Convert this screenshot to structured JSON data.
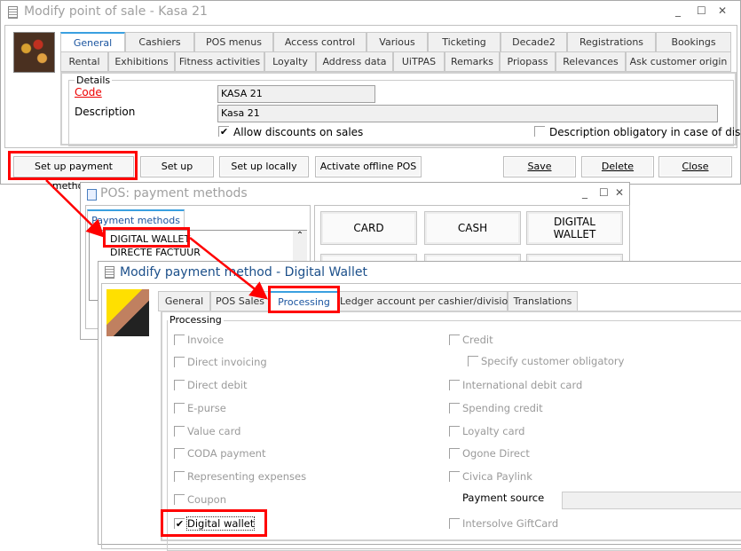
{
  "pos_window": {
    "title": "Modify point of sale - Kasa 21",
    "tabs_row1": [
      "General",
      "Cashiers",
      "POS menus",
      "Access control",
      "Various",
      "Ticketing",
      "Decade2",
      "Registrations",
      "Bookings"
    ],
    "tabs_row2": [
      "Rental",
      "Exhibitions",
      "Fitness activities",
      "Loyalty",
      "Address data",
      "UiTPAS",
      "Remarks",
      "Priopass",
      "Relevances",
      "Ask customer origin"
    ],
    "active_tab": "General",
    "details": {
      "group_label": "Details",
      "code_label": "Code",
      "code_value": "KASA 21",
      "description_label": "Description",
      "description_value": "Kasa 21",
      "allow_discounts_label": "Allow discounts on sales",
      "allow_discounts_checked": true,
      "description_obligatory_label": "Description obligatory in case of dis",
      "description_obligatory_checked": false
    },
    "buttons": {
      "setup_payment": "Set up payment methods",
      "setup": "Set up",
      "setup_locally": "Set up locally",
      "activate_offline": "Activate offline POS",
      "save": "Save",
      "delete": "Delete",
      "close": "Close"
    }
  },
  "pm_window": {
    "title": "POS: payment methods",
    "tab": "Payment methods",
    "list": [
      "DIGITAL WALLET",
      "DIRECTE FACTUUR"
    ],
    "tiles": [
      "CARD",
      "CASH",
      "DIGITAL WALLET"
    ]
  },
  "modify_window": {
    "title": "Modify payment method - Digital Wallet",
    "tabs": [
      "General",
      "POS Sales",
      "Processing",
      "Ledger account per cashier/division",
      "Translations"
    ],
    "active_tab": "Processing",
    "group_label": "Processing",
    "left": [
      {
        "label": "Invoice",
        "checked": false
      },
      {
        "label": "Direct invoicing",
        "checked": false
      },
      {
        "label": "Direct debit",
        "checked": false
      },
      {
        "label": "E-purse",
        "checked": false
      },
      {
        "label": "Value card",
        "checked": false
      },
      {
        "label": "CODA payment",
        "checked": false
      },
      {
        "label": "Representing expenses",
        "checked": false
      },
      {
        "label": "Coupon",
        "checked": false
      },
      {
        "label": "Digital wallet",
        "checked": true
      }
    ],
    "right": [
      {
        "label": "Credit",
        "checked": false
      },
      {
        "label": "Specify customer obligatory",
        "checked": false
      },
      {
        "label": "International debit card",
        "checked": false
      },
      {
        "label": "Spending credit",
        "checked": false
      },
      {
        "label": "Loyalty card",
        "checked": false
      },
      {
        "label": "Ogone Direct",
        "checked": false
      },
      {
        "label": "Civica Paylink",
        "checked": false
      },
      {
        "label": "Intersolve GiftCard",
        "checked": false
      }
    ],
    "payment_source_label": "Payment source",
    "payment_source_value": ""
  },
  "colors": {
    "highlight": "#ff0000",
    "active_tab": "#3aa0e0"
  }
}
